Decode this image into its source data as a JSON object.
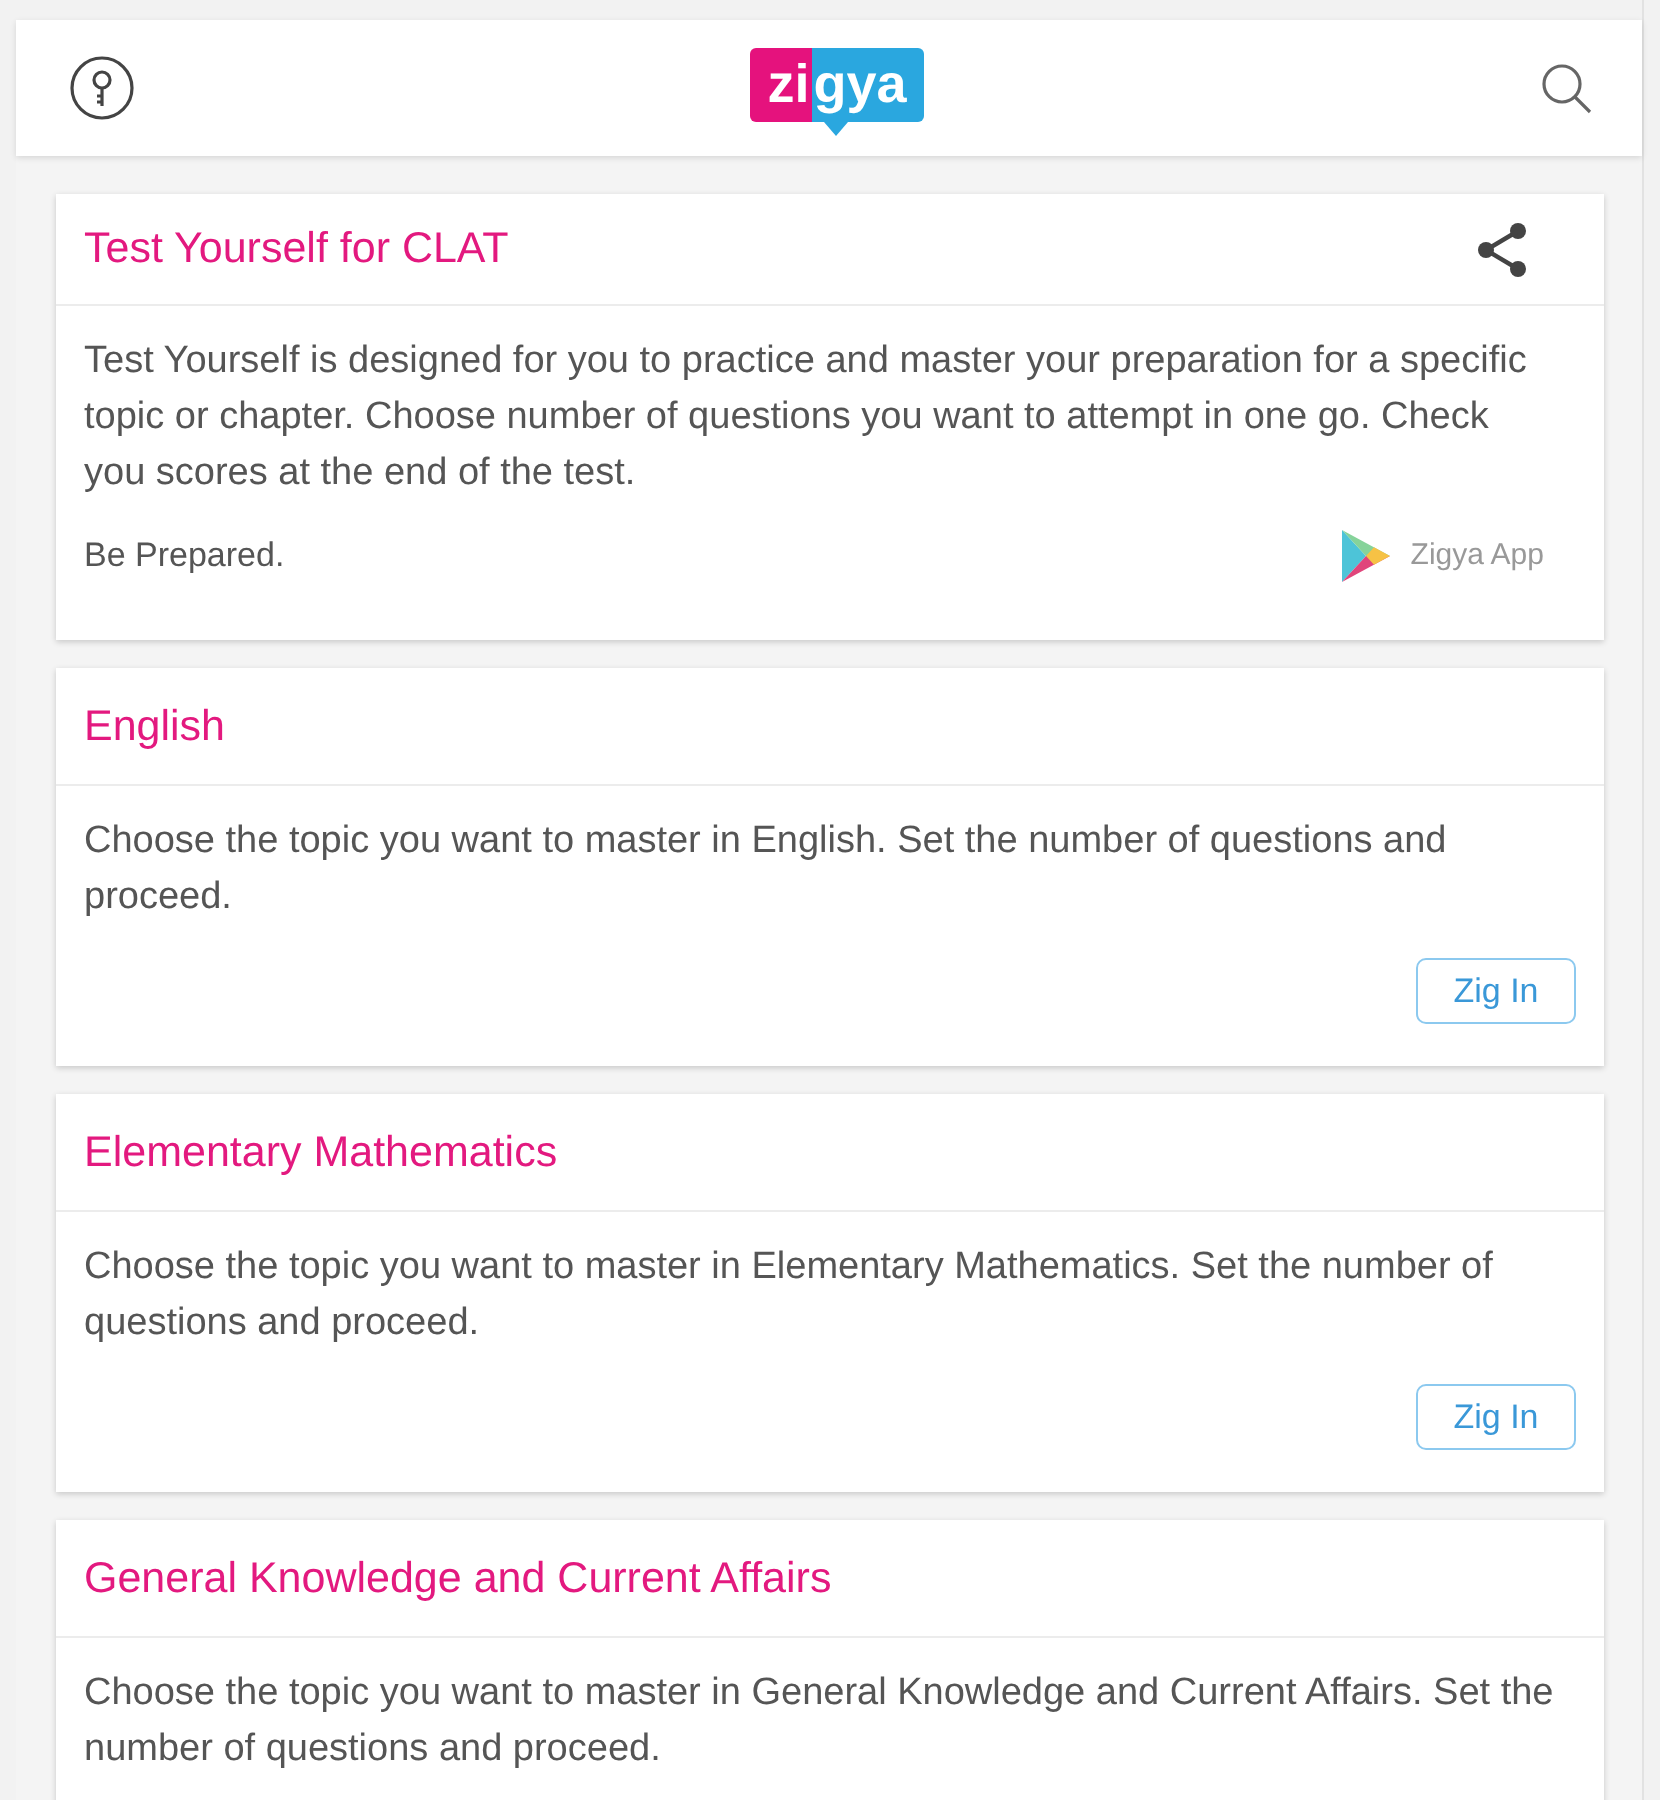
{
  "header": {
    "logo": [
      {
        "text": "zi",
        "color": "#e5127d"
      },
      {
        "text": "gya",
        "color": "#2aa7df"
      }
    ]
  },
  "cards": [
    {
      "kind": "intro",
      "title": "Test Yourself for CLAT",
      "description": "Test Yourself is designed for you to practice and master your preparation for a specific topic or chapter. Choose number of questions you want to attempt in one go. Check you scores at the end of the test.",
      "tagline": "Be Prepared.",
      "app_link": "Zigya App"
    },
    {
      "kind": "topic",
      "title": "English",
      "description": "Choose the topic you want to master in English. Set the number of questions and proceed.",
      "button": "Zig In"
    },
    {
      "kind": "topic",
      "title": "Elementary Mathematics",
      "description": "Choose the topic you want to master in Elementary Mathematics. Set the number of questions and proceed.",
      "button": "Zig In"
    },
    {
      "kind": "topic",
      "title": "General Knowledge and Current Affairs",
      "description": "Choose the topic you want to master in General Knowledge and Current Affairs. Set the number of questions and proceed."
    }
  ]
}
